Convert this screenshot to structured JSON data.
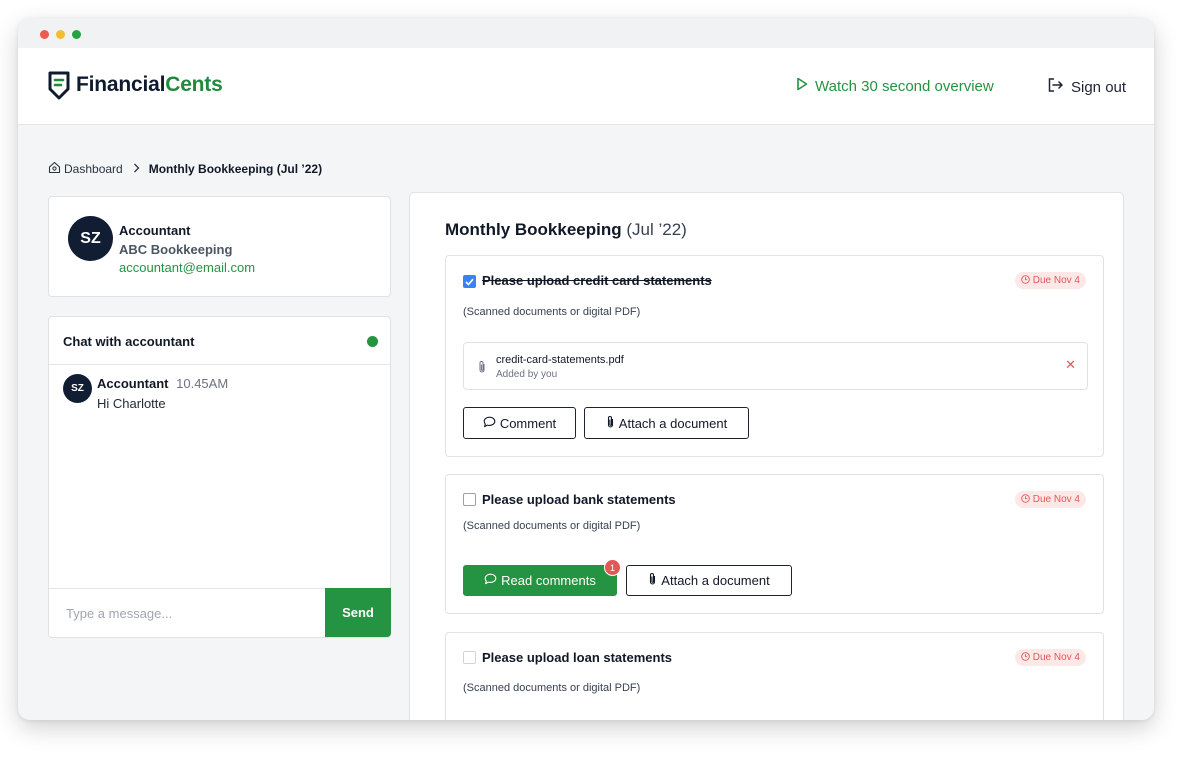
{
  "window": {
    "controls": [
      "close",
      "minimize",
      "maximize"
    ]
  },
  "header": {
    "logo": {
      "brand_part1": "Financial",
      "brand_part2": "Cents",
      "icon": "financialcents-logo-icon"
    },
    "watch_label": "Watch 30 second overview",
    "signout_label": "Sign out",
    "accent_color": "#249342"
  },
  "breadcrumb": {
    "home": "Dashboard",
    "current": "Monthly Bookkeeping (Jul ’22)"
  },
  "accountant": {
    "initials": "SZ",
    "role": "Accountant",
    "company": "ABC Bookkeeping",
    "email": "accountant@email.com"
  },
  "chat": {
    "title": "Chat with accountant",
    "status": "online",
    "messages": [
      {
        "initials": "SZ",
        "sender": "Accountant",
        "time": "10.45AM",
        "text": "Hi Charlotte"
      }
    ],
    "input_placeholder": "Type a message...",
    "send_label": "Send"
  },
  "main": {
    "title": "Monthly Bookkeeping",
    "period": "(Jul ’22)",
    "tasks": [
      {
        "checked": true,
        "title": "Please upload credit card statements",
        "subtitle": "(Scanned documents or digital PDF)",
        "due": "Due Nov 4",
        "attachment": {
          "name": "credit-card-statements.pdf",
          "meta": "Added by you"
        },
        "buttons": {
          "comment": "Comment",
          "attach": "Attach a document"
        }
      },
      {
        "checked": false,
        "title": "Please upload bank statements",
        "subtitle": "(Scanned documents or digital PDF)",
        "due": "Due Nov 4",
        "buttons": {
          "read_comments": "Read comments",
          "unread_count": "1",
          "attach": "Attach a document"
        }
      },
      {
        "checked": false,
        "title": "Please upload loan statements",
        "subtitle": "(Scanned documents or digital PDF)",
        "due": "Due Nov 4"
      }
    ]
  }
}
